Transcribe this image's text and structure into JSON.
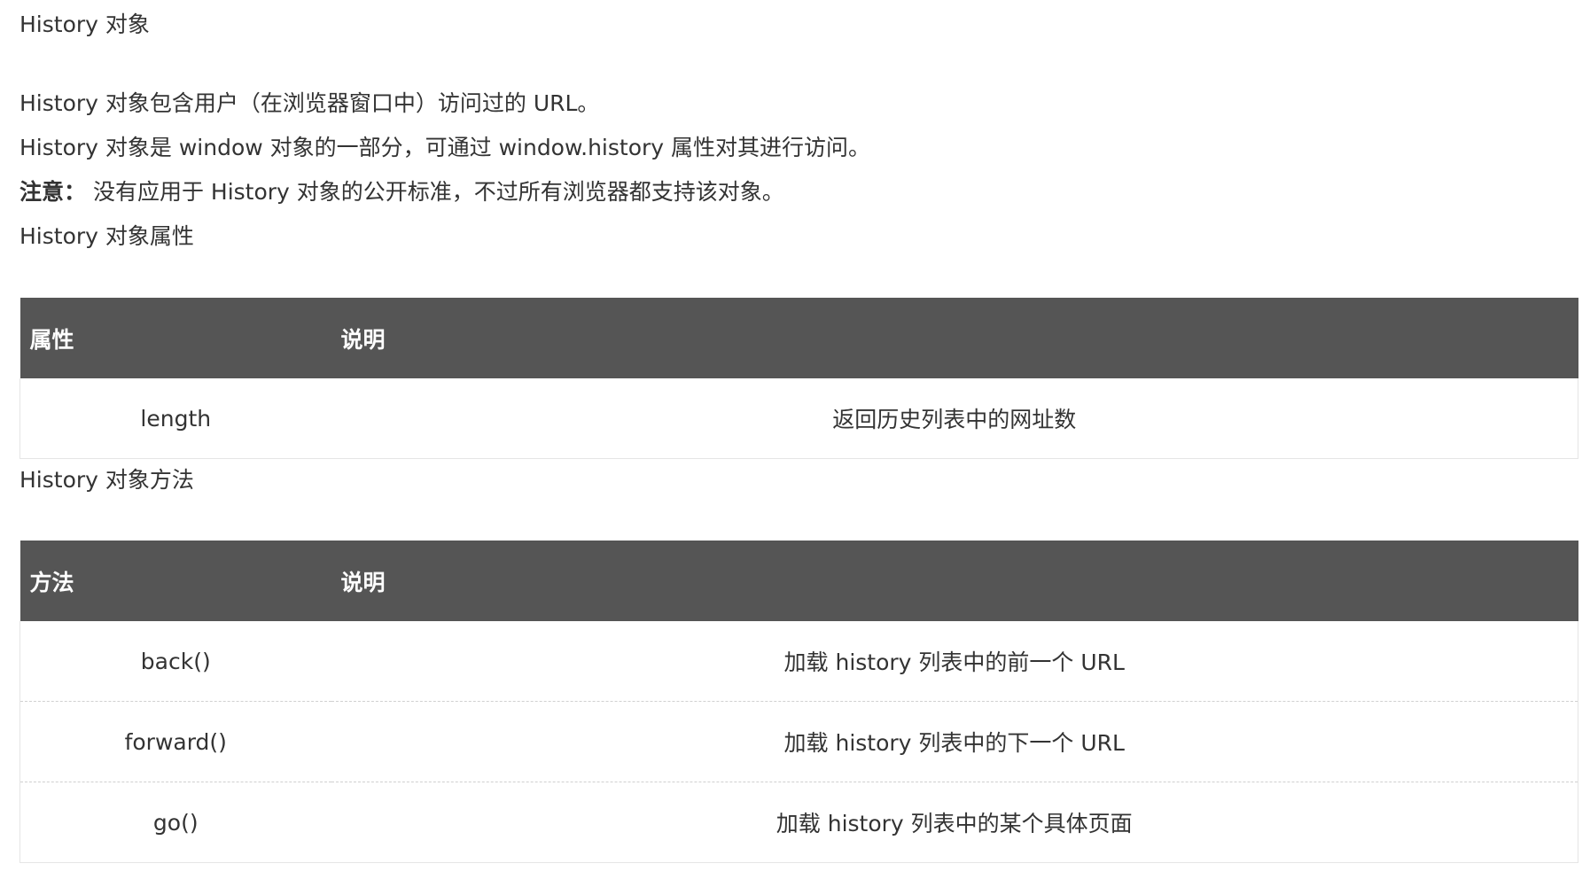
{
  "heading": "History 对象",
  "paragraphs": [
    "History 对象包含用户（在浏览器窗口中）访问过的 URL。",
    "History 对象是 window 对象的一部分，可通过 window.history 属性对其进行访问。"
  ],
  "note": {
    "label": "注意：",
    "text": " 没有应用于 History 对象的公开标准，不过所有浏览器都支持该对象。"
  },
  "properties_section": {
    "title": "History 对象属性",
    "headers": [
      "属性",
      "说明"
    ],
    "rows": [
      {
        "name": "length",
        "desc": "返回历史列表中的网址数"
      }
    ]
  },
  "methods_section": {
    "title": "History 对象方法",
    "headers": [
      "方法",
      "说明"
    ],
    "rows": [
      {
        "name": "back()",
        "desc": "加载 history 列表中的前一个 URL"
      },
      {
        "name": "forward()",
        "desc": "加载 history 列表中的下一个 URL"
      },
      {
        "name": "go()",
        "desc": "加载 history 列表中的某个具体页面"
      }
    ]
  }
}
